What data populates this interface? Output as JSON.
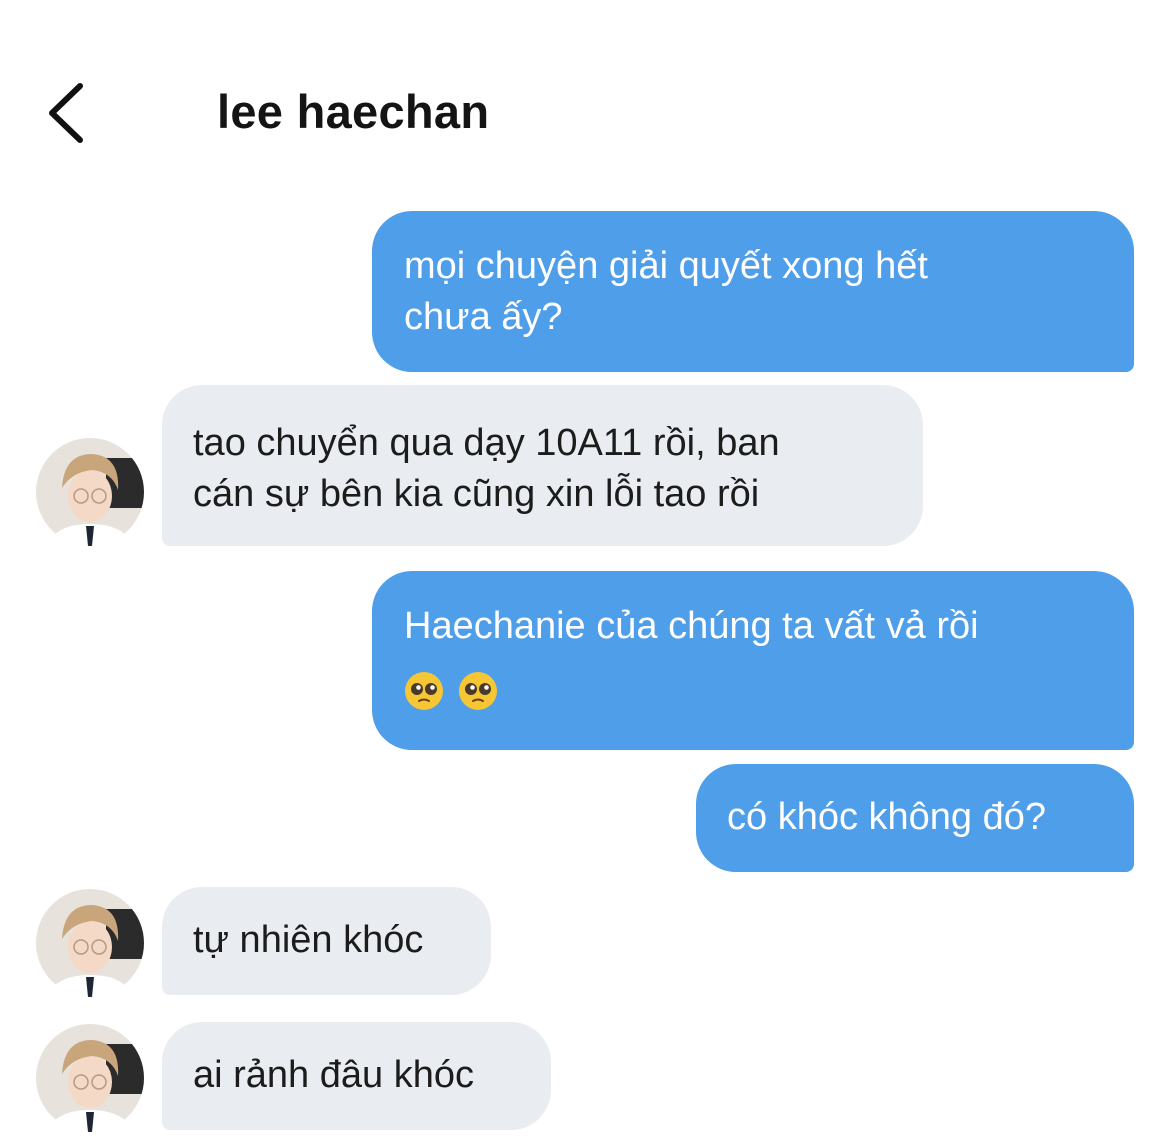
{
  "header": {
    "title": "lee haechan",
    "back_icon": "chevron-left-icon"
  },
  "colors": {
    "outgoing_bubble": "#4e9ee9",
    "incoming_bubble": "#e9ecf0",
    "outgoing_text": "#ffffff",
    "incoming_text": "#1c1c1c"
  },
  "messages": [
    {
      "direction": "outgoing",
      "text": "mọi chuyện giải quyết xong hết\nchưa ấy?"
    },
    {
      "direction": "incoming",
      "text": "tao chuyển qua dạy 10A11 rồi, ban\ncán sự bên kia cũng xin lỗi tao rồi"
    },
    {
      "direction": "outgoing",
      "text": "Haechanie của chúng ta vất vả rồi",
      "emojis": [
        "pleading-face",
        "pleading-face"
      ]
    },
    {
      "direction": "outgoing",
      "text": "có khóc không đó?"
    },
    {
      "direction": "incoming",
      "text": "tự nhiên khóc"
    },
    {
      "direction": "incoming",
      "text": "ai rảnh đâu khóc"
    }
  ]
}
